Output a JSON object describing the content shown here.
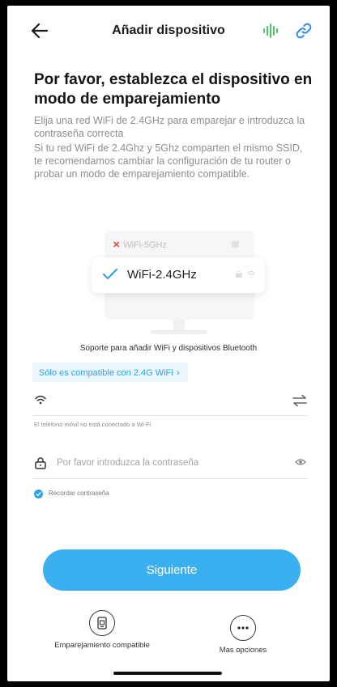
{
  "header": {
    "title": "Añadir dispositivo",
    "icons": {
      "back": "arrow-left-icon",
      "sound": "sound-wave-icon",
      "link": "link-icon"
    },
    "accent_colors": {
      "sound": "#4cc46a",
      "link": "#2f8cf0"
    }
  },
  "content": {
    "headline": "Por favor, establezca el dispositivo en modo de emparejamiento",
    "description_1": "Elija una red WiFi de 2.4GHz para emparejar e introduzca la contraseña correcta",
    "description_2": "Si tu red WiFi de 2.4Ghz y 5Ghz comparten el mismo SSID, te recomendamos cambiar la configuración de tu router o probar un modo de emparejamiento compatible."
  },
  "illustration": {
    "wifi_5g_label": "WiFi-5GHz",
    "wifi_24g_label": "WiFi-2.4GHz"
  },
  "support_text": "Soporte para añadir WiFi y dispositivos Bluetooth",
  "compat_chip": {
    "label": "Sólo es compatible con 2.4G WiFi",
    "arrow": "›"
  },
  "wifi_field": {
    "value": "",
    "note": "El teléfono móvil no está conectado a Wi-Fi"
  },
  "password_field": {
    "value": "",
    "placeholder": "Por favor introduzca la contraseña"
  },
  "remember": {
    "label": "Recordar contraseña",
    "checked": true
  },
  "next_button": {
    "label": "Siguiente"
  },
  "options": [
    {
      "label": "Emparejamiento compatible",
      "icon": "compatible-pairing-icon"
    },
    {
      "label": "Mas opciones",
      "icon": "more-options-icon"
    }
  ],
  "colors": {
    "primary": "#3ab0f0",
    "chip_bg": "#eaf6fe",
    "chip_text": "#2fa1ea",
    "error_x": "#e2403b"
  }
}
